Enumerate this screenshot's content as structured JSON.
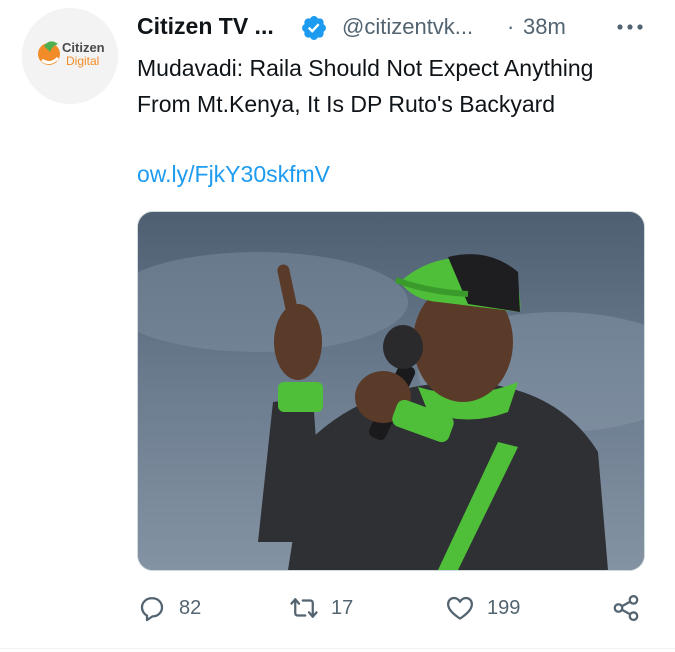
{
  "account": {
    "display_name": "Citizen TV ...",
    "handle": "@citizentvk...",
    "separator": "·",
    "time": "38m",
    "verified": true,
    "avatar_logo_text_1": "Citizen",
    "avatar_logo_text_2": "Digital"
  },
  "tweet": {
    "text": "Mudavadi: Raila Should Not Expect Anything From Mt.Kenya, It Is DP Ruto's Backyard",
    "link": "ow.ly/FjkY30skfmV"
  },
  "stats": {
    "replies": "82",
    "retweets": "17",
    "likes": "199"
  },
  "colors": {
    "link": "#1d9bf0",
    "verified": "#1d9bf0",
    "muted": "#536471",
    "logo_orange": "#f28c28",
    "logo_green": "#4caf50"
  },
  "icons": [
    "verified-badge-icon",
    "more-options-icon",
    "reply-icon",
    "retweet-icon",
    "like-icon",
    "share-icon"
  ]
}
